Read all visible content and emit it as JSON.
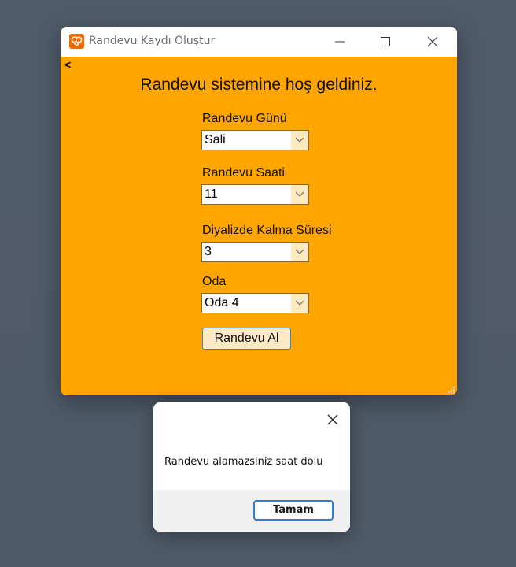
{
  "window": {
    "title": "Randevu Kaydı Oluştur",
    "back_label": "<"
  },
  "form": {
    "welcome": "Randevu sistemine hoş geldiniz.",
    "fields": [
      {
        "label": "Randevu Günü",
        "value": "Sali"
      },
      {
        "label": "Randevu Saati",
        "value": "11"
      },
      {
        "label": "Diyalizde Kalma Süresi",
        "value": "3"
      },
      {
        "label": "Oda",
        "value": "Oda 4"
      }
    ],
    "submit_label": "Randevu Al"
  },
  "dialog": {
    "message": "Randevu alamazsiniz saat dolu",
    "ok_label": "Tamam"
  },
  "colors": {
    "accent": "#ffa500",
    "app_icon": "#f06c00",
    "focus_border": "#2f7cd0"
  },
  "icons": {
    "app": "heart-icon",
    "minimize": "minimize-icon",
    "maximize": "maximize-icon",
    "close": "close-icon",
    "dropdown": "chevron-down-icon"
  }
}
